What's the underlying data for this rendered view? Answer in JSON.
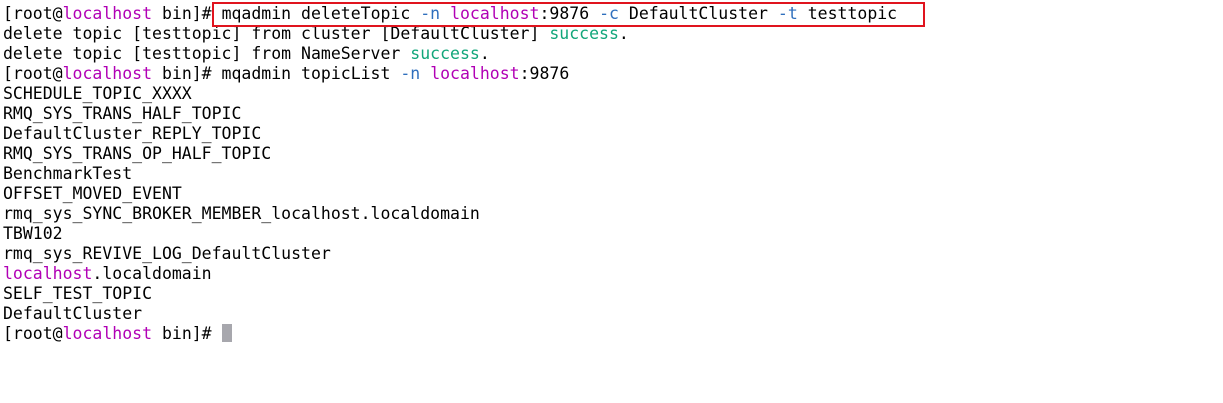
{
  "terminal": {
    "lines": [
      {
        "segments": [
          {
            "text": "[root@",
            "style": "plain"
          },
          {
            "text": "localhost",
            "style": "host"
          },
          {
            "text": " bin]# ",
            "style": "plain"
          },
          {
            "text": "mqadmin deleteTopic ",
            "style": "plain"
          },
          {
            "text": "-n",
            "style": "flag"
          },
          {
            "text": " ",
            "style": "plain"
          },
          {
            "text": "localhost",
            "style": "host"
          },
          {
            "text": ":9876 ",
            "style": "plain"
          },
          {
            "text": "-c",
            "style": "flag"
          },
          {
            "text": " DefaultCluster ",
            "style": "plain"
          },
          {
            "text": "-t",
            "style": "flag"
          },
          {
            "text": " testtopic",
            "style": "plain"
          }
        ]
      },
      {
        "segments": [
          {
            "text": "delete topic [testtopic] from cluster [DefaultCluster] ",
            "style": "plain"
          },
          {
            "text": "success",
            "style": "success"
          },
          {
            "text": ".",
            "style": "plain"
          }
        ]
      },
      {
        "segments": [
          {
            "text": "delete topic [testtopic] from NameServer ",
            "style": "plain"
          },
          {
            "text": "success",
            "style": "success"
          },
          {
            "text": ".",
            "style": "plain"
          }
        ]
      },
      {
        "segments": [
          {
            "text": "[root@",
            "style": "plain"
          },
          {
            "text": "localhost",
            "style": "host"
          },
          {
            "text": " bin]# mqadmin topicList ",
            "style": "plain"
          },
          {
            "text": "-n",
            "style": "flag"
          },
          {
            "text": " ",
            "style": "plain"
          },
          {
            "text": "localhost",
            "style": "host"
          },
          {
            "text": ":9876",
            "style": "plain"
          }
        ]
      },
      {
        "segments": [
          {
            "text": "SCHEDULE_TOPIC_XXXX",
            "style": "plain"
          }
        ]
      },
      {
        "segments": [
          {
            "text": "RMQ_SYS_TRANS_HALF_TOPIC",
            "style": "plain"
          }
        ]
      },
      {
        "segments": [
          {
            "text": "DefaultCluster_REPLY_TOPIC",
            "style": "plain"
          }
        ]
      },
      {
        "segments": [
          {
            "text": "RMQ_SYS_TRANS_OP_HALF_TOPIC",
            "style": "plain"
          }
        ]
      },
      {
        "segments": [
          {
            "text": "BenchmarkTest",
            "style": "plain"
          }
        ]
      },
      {
        "segments": [
          {
            "text": "OFFSET_MOVED_EVENT",
            "style": "plain"
          }
        ]
      },
      {
        "segments": [
          {
            "text": "rmq_sys_SYNC_BROKER_MEMBER_localhost.localdomain",
            "style": "plain"
          }
        ]
      },
      {
        "segments": [
          {
            "text": "TBW102",
            "style": "plain"
          }
        ]
      },
      {
        "segments": [
          {
            "text": "rmq_sys_REVIVE_LOG_DefaultCluster",
            "style": "plain"
          }
        ]
      },
      {
        "segments": [
          {
            "text": "localhost",
            "style": "host"
          },
          {
            "text": ".localdomain",
            "style": "plain"
          }
        ]
      },
      {
        "segments": [
          {
            "text": "SELF_TEST_TOPIC",
            "style": "plain"
          }
        ]
      },
      {
        "segments": [
          {
            "text": "DefaultCluster",
            "style": "plain"
          }
        ]
      },
      {
        "segments": [
          {
            "text": "[root@",
            "style": "plain"
          },
          {
            "text": "localhost",
            "style": "host"
          },
          {
            "text": " bin]# ",
            "style": "plain"
          }
        ],
        "cursor": true
      }
    ]
  },
  "colors": {
    "background": "#ffffff",
    "text": "#000000",
    "host": "#b100b5",
    "flag": "#2f6fbd",
    "success": "#12a67a",
    "highlight_border": "#e0141e",
    "cursor": "#a7a7ad"
  }
}
